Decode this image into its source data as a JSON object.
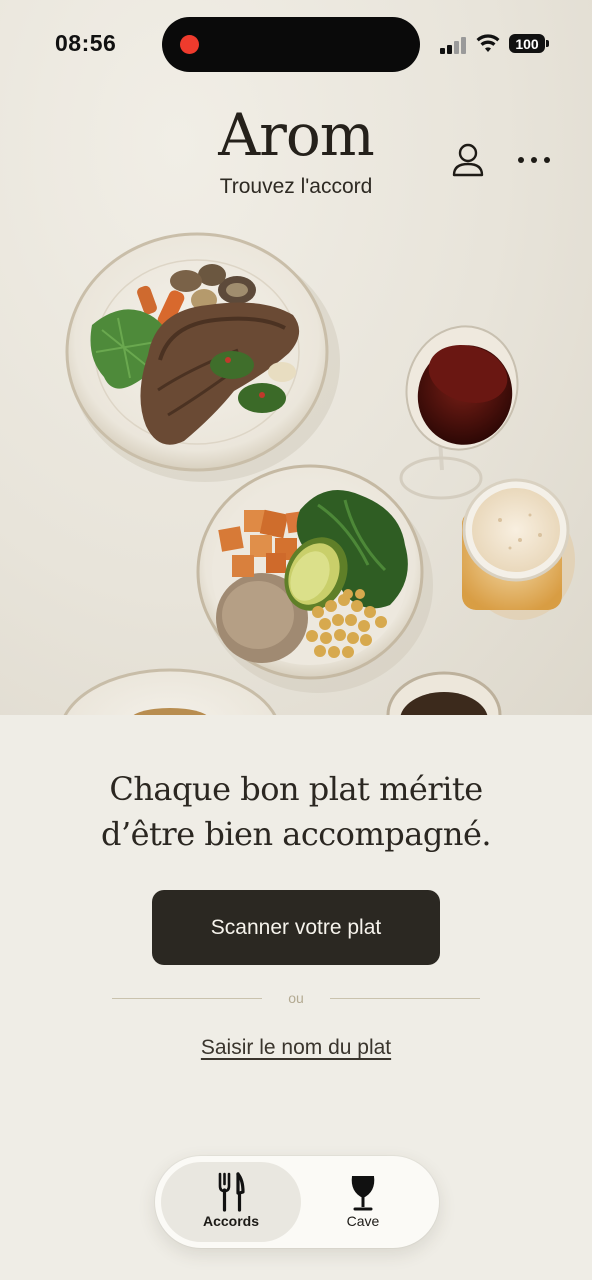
{
  "status_bar": {
    "time": "08:56",
    "battery": "100"
  },
  "header": {
    "title": "Arom",
    "subtitle": "Trouvez l'accord",
    "profile_icon": "person-icon",
    "more_icon": "ellipsis-icon"
  },
  "hero": {
    "image": "table-with-steak-plate-grain-bowl-red-wine-and-beer"
  },
  "main": {
    "headline_line1": "Chaque bon plat mérite",
    "headline_line2": "d’être bien accompagné.",
    "scan_button_label": "Scanner votre plat",
    "divider_text": "ou",
    "type_link_label": "Saisir le nom du plat"
  },
  "tab_bar": {
    "tabs": [
      {
        "label": "Accords",
        "icon": "fork-knife-icon",
        "active": true
      },
      {
        "label": "Cave",
        "icon": "wine-glass-icon",
        "active": false
      }
    ]
  },
  "colors": {
    "background": "#efede6",
    "button_dark": "#2b2822",
    "recording_dot": "#ef3b2d",
    "divider": "#c9c2ad"
  }
}
